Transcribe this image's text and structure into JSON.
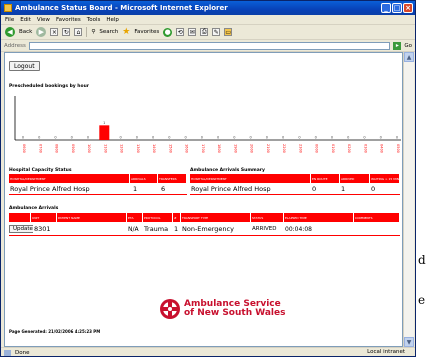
{
  "outer": {
    "text_1": "d",
    "text_2": "e"
  },
  "window": {
    "title": "Ambulance Status Board - Microsoft Internet Explorer",
    "menu": [
      "File",
      "Edit",
      "View",
      "Favorites",
      "Tools",
      "Help"
    ],
    "toolbar": {
      "back_label": "Back",
      "search_label": "Search",
      "favorites_label": "Favorites"
    },
    "address_label": "Address",
    "go_label": "Go",
    "status_left": "Done",
    "status_zone": "Local intranet"
  },
  "page": {
    "logout_label": "Logout",
    "chart_title": "Prescheduled bookings by hour",
    "hospital_capacity": {
      "title": "Hospital Capacity Status",
      "headers": [
        "HOSPITAL/DEPARTMENT",
        "ARRIVALS",
        "TRANSFERS"
      ],
      "row": [
        "Royal Prince Alfred Hosp",
        "1",
        "6"
      ]
    },
    "ambulance_summary": {
      "title": "Ambulance Arrivals Summary",
      "headers": [
        "HOSPITAL/DEPARTMENT",
        "EN ROUTE",
        "ARRIVED",
        "WAITING > 15 MINS"
      ],
      "row": [
        "Royal Prince Alfred Hosp",
        "0",
        "1",
        "0"
      ]
    },
    "ambulance_arrivals": {
      "title": "Ambulance Arrivals",
      "headers": [
        "",
        "UNIT",
        "PATIENT NAME",
        "ETA",
        "PROTOCOL",
        "#",
        "TRANSPORT TYPE",
        "STATUS",
        "ELAPSED TIME",
        "COMMENTS"
      ],
      "row": {
        "update_label": "Update",
        "unit": "8301",
        "patient": "",
        "eta": "N/A",
        "protocol": "Trauma",
        "count": "1",
        "transport": "Non-Emergency",
        "status": "ARRIVED",
        "elapsed": "00:04:08",
        "comments": ""
      }
    },
    "logo_text_1": "Ambulance Service",
    "logo_text_2": "of New South Wales",
    "page_generated": "Page Generated: 21/02/2006 4:25:23 PM"
  },
  "chart_data": {
    "type": "bar",
    "title": "Prescheduled bookings by hour",
    "categories": [
      "0600",
      "0700",
      "0800",
      "0900",
      "1000",
      "1100",
      "1200",
      "1300",
      "1400",
      "1500",
      "1600",
      "1700",
      "1800",
      "1900",
      "2000",
      "2100",
      "2200",
      "2300",
      "0000",
      "0100",
      "0200",
      "0300",
      "0400",
      "0500"
    ],
    "values": [
      0,
      0,
      0,
      0,
      0,
      1,
      0,
      0,
      0,
      0,
      0,
      0,
      0,
      0,
      0,
      0,
      0,
      0,
      0,
      0,
      0,
      0,
      0,
      0
    ],
    "ylim": [
      0,
      3
    ],
    "bar_color": "#ff0000"
  },
  "colors": {
    "accent_red": "#ff0000",
    "title_blue": "#0842b8",
    "logo_red": "#c8102e"
  }
}
